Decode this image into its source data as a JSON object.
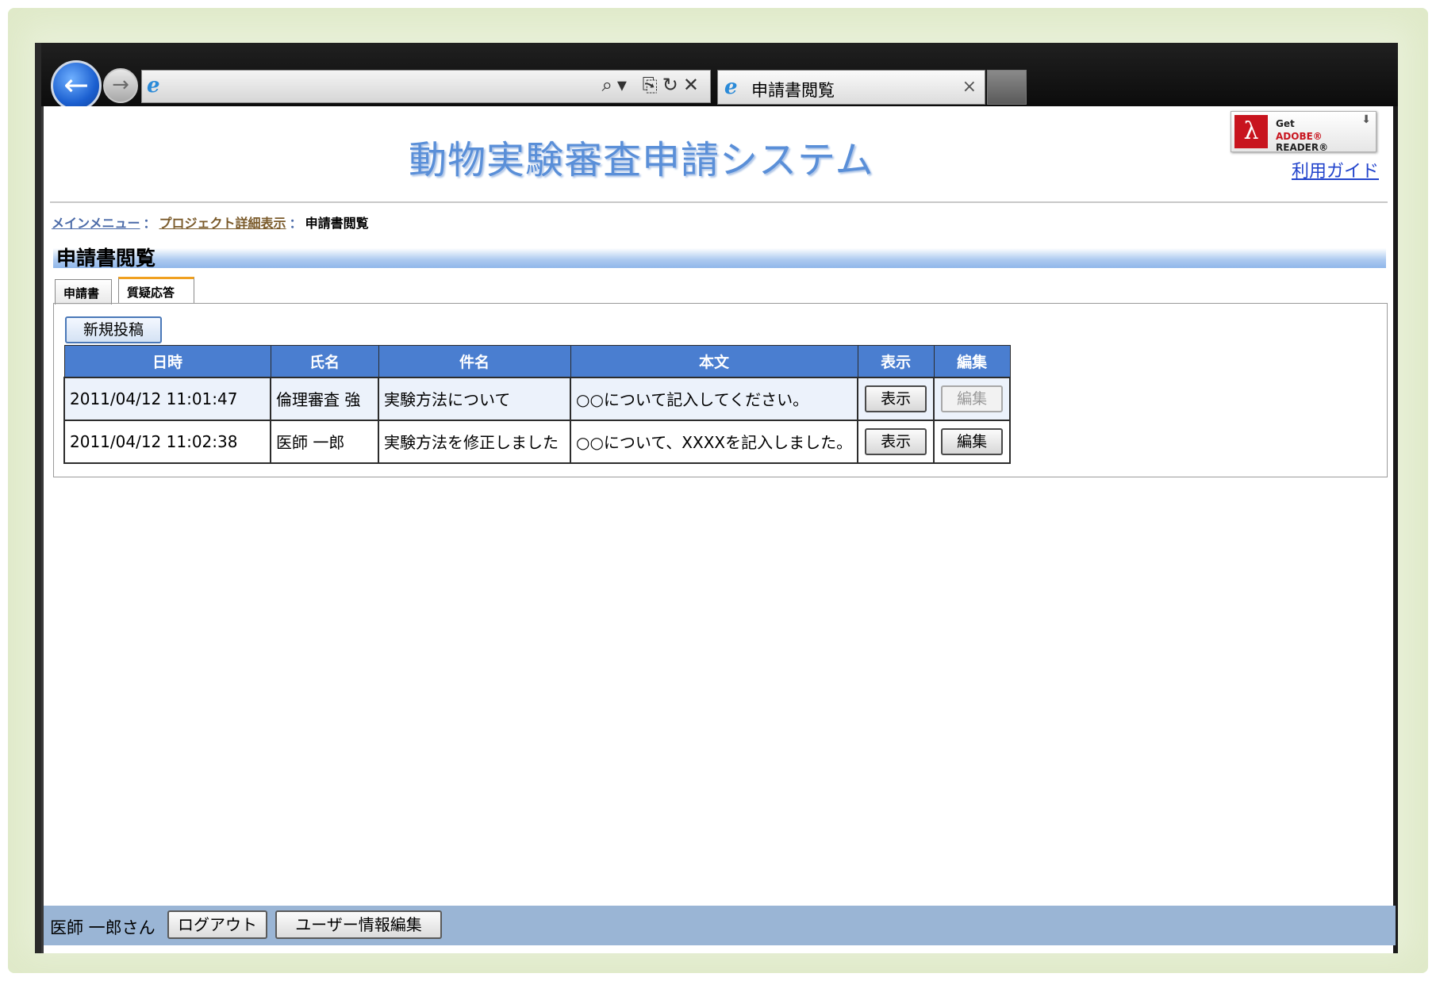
{
  "browser": {
    "tab_title": "申請書閲覧",
    "back_glyph": "←",
    "forward_glyph": "→",
    "ie_glyph": "e",
    "addr_tools": "⌕▾ ⎘↻✕",
    "close_glyph": "×"
  },
  "header": {
    "site_title": "動物実験審査申請システム",
    "adobe": {
      "get": "Get",
      "brand": "ADOBE®",
      "reader": "READER®",
      "logo_glyph": "λ"
    },
    "guide_link": "利用ガイド"
  },
  "breadcrumb": {
    "items": [
      "メインメニュー",
      "プロジェクト詳細表示",
      "申請書閲覧"
    ],
    "separator": "："
  },
  "section": {
    "title": "申請書閲覧"
  },
  "tabs": [
    {
      "label": "申請書",
      "active": false
    },
    {
      "label": "質疑応答",
      "active": true
    }
  ],
  "actions": {
    "new_post": "新規投稿"
  },
  "table": {
    "headers": [
      "日時",
      "氏名",
      "件名",
      "本文",
      "表示",
      "編集"
    ],
    "rows": [
      {
        "datetime": "2011/04/12 11:01:47",
        "name": "倫理審査 強",
        "subject": "実験方法について",
        "body": "○○について記入してください。",
        "view": "表示",
        "edit": "編集",
        "edit_enabled": false
      },
      {
        "datetime": "2011/04/12 11:02:38",
        "name": "医師 一郎",
        "subject": "実験方法を修正しました",
        "body": "○○について、XXXXを記入しました。",
        "view": "表示",
        "edit": "編集",
        "edit_enabled": true
      }
    ]
  },
  "footer": {
    "user": "医師 一郎さん",
    "logout": "ログアウト",
    "edit_user": "ユーザー情報編集"
  }
}
